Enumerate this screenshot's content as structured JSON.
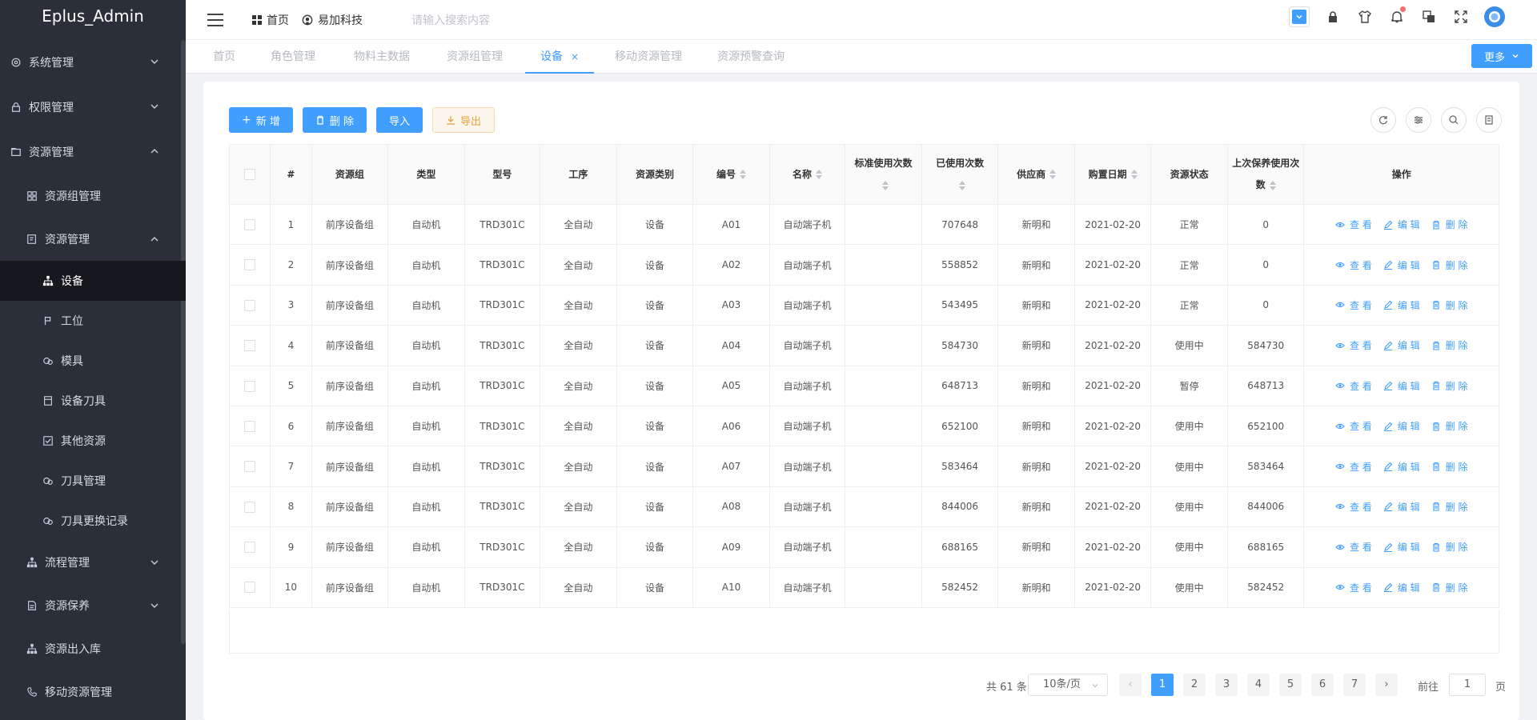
{
  "app_title": "Eplus_Admin",
  "sidebar": {
    "items": [
      {
        "label": "系统管理",
        "icon": "gear-icon",
        "arrow": "down"
      },
      {
        "label": "权限管理",
        "icon": "lock-icon",
        "arrow": "down"
      },
      {
        "label": "资源管理",
        "icon": "folder-icon",
        "arrow": "up"
      }
    ],
    "resource_children": [
      {
        "label": "资源组管理",
        "icon": "grid-icon"
      },
      {
        "label": "资源管理",
        "icon": "edit-doc-icon",
        "arrow": "up"
      }
    ],
    "resource_leaves": [
      {
        "label": "设备",
        "icon": "org-chart-icon",
        "active": true
      },
      {
        "label": "工位",
        "icon": "flag-icon"
      },
      {
        "label": "模具",
        "icon": "link-icon"
      },
      {
        "label": "设备刀具",
        "icon": "clipboard-icon"
      },
      {
        "label": "其他资源",
        "icon": "checkbox-icon"
      },
      {
        "label": "刀具管理",
        "icon": "link-icon"
      },
      {
        "label": "刀具更换记录",
        "icon": "link-icon"
      }
    ],
    "bottom_items": [
      {
        "label": "流程管理",
        "icon": "org-chart-icon",
        "arrow": "down"
      },
      {
        "label": "资源保养",
        "icon": "document-icon",
        "arrow": "down"
      },
      {
        "label": "资源出入库",
        "icon": "org-chart-icon"
      },
      {
        "label": "移动资源管理",
        "icon": "phone-icon"
      }
    ]
  },
  "header": {
    "nav": [
      {
        "label": "首页",
        "icon": "apps-icon"
      },
      {
        "label": "易加科技",
        "icon": "github-icon"
      }
    ],
    "search_placeholder": "请输入搜索内容"
  },
  "tabs": [
    {
      "label": "首页",
      "active": false
    },
    {
      "label": "角色管理",
      "active": false
    },
    {
      "label": "物料主数据",
      "active": false
    },
    {
      "label": "资源组管理",
      "active": false
    },
    {
      "label": "设备",
      "active": true,
      "closable": true
    },
    {
      "label": "移动资源管理",
      "active": false
    },
    {
      "label": "资源预警查询",
      "active": false
    }
  ],
  "tab_close": "×",
  "more_label": "更多",
  "toolbar": {
    "add": "新 增",
    "delete": "删 除",
    "import": "导入",
    "export": "导出"
  },
  "table": {
    "columns": [
      "#",
      "资源组",
      "类型",
      "型号",
      "工序",
      "资源类别",
      "编号",
      "名称",
      "标准使用次数",
      "已使用次数",
      "供应商",
      "购置日期",
      "资源状态",
      "上次保养使用次数",
      "操作"
    ],
    "ops": {
      "view": "查 看",
      "edit": "编 辑",
      "delete": "删 除"
    },
    "rows": [
      [
        "1",
        "前序设备组",
        "自动机",
        "TRD301C",
        "全自动",
        "设备",
        "A01",
        "自动端子机",
        "",
        "707648",
        "新明和",
        "2021-02-20",
        "正常",
        "0"
      ],
      [
        "2",
        "前序设备组",
        "自动机",
        "TRD301C",
        "全自动",
        "设备",
        "A02",
        "自动端子机",
        "",
        "558852",
        "新明和",
        "2021-02-20",
        "正常",
        "0"
      ],
      [
        "3",
        "前序设备组",
        "自动机",
        "TRD301C",
        "全自动",
        "设备",
        "A03",
        "自动端子机",
        "",
        "543495",
        "新明和",
        "2021-02-20",
        "正常",
        "0"
      ],
      [
        "4",
        "前序设备组",
        "自动机",
        "TRD301C",
        "全自动",
        "设备",
        "A04",
        "自动端子机",
        "",
        "584730",
        "新明和",
        "2021-02-20",
        "使用中",
        "584730"
      ],
      [
        "5",
        "前序设备组",
        "自动机",
        "TRD301C",
        "全自动",
        "设备",
        "A05",
        "自动端子机",
        "",
        "648713",
        "新明和",
        "2021-02-20",
        "暂停",
        "648713"
      ],
      [
        "6",
        "前序设备组",
        "自动机",
        "TRD301C",
        "全自动",
        "设备",
        "A06",
        "自动端子机",
        "",
        "652100",
        "新明和",
        "2021-02-20",
        "使用中",
        "652100"
      ],
      [
        "7",
        "前序设备组",
        "自动机",
        "TRD301C",
        "全自动",
        "设备",
        "A07",
        "自动端子机",
        "",
        "583464",
        "新明和",
        "2021-02-20",
        "使用中",
        "583464"
      ],
      [
        "8",
        "前序设备组",
        "自动机",
        "TRD301C",
        "全自动",
        "设备",
        "A08",
        "自动端子机",
        "",
        "844006",
        "新明和",
        "2021-02-20",
        "使用中",
        "844006"
      ],
      [
        "9",
        "前序设备组",
        "自动机",
        "TRD301C",
        "全自动",
        "设备",
        "A09",
        "自动端子机",
        "",
        "688165",
        "新明和",
        "2021-02-20",
        "使用中",
        "688165"
      ],
      [
        "10",
        "前序设备组",
        "自动机",
        "TRD301C",
        "全自动",
        "设备",
        "A10",
        "自动端子机",
        "",
        "582452",
        "新明和",
        "2021-02-20",
        "使用中",
        "582452"
      ]
    ]
  },
  "pagination": {
    "total_text": "共 61 条",
    "page_size": "10条/页",
    "pages": [
      "1",
      "2",
      "3",
      "4",
      "5",
      "6",
      "7"
    ],
    "current": "1",
    "prev": "‹",
    "next": "›",
    "goto_label": "前往",
    "goto_value": "1",
    "page_suffix": "页"
  },
  "colors": {
    "primary": "#409eff",
    "sidebar_bg": "#2b2f3a",
    "warn": "#e6a23c"
  }
}
